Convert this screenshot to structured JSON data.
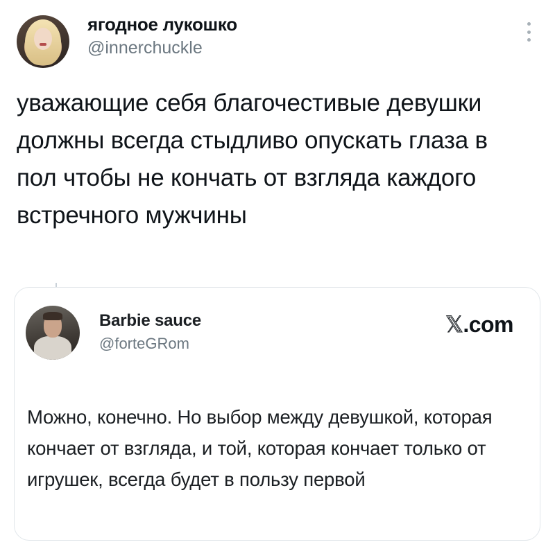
{
  "tweet": {
    "author": {
      "display_name": "ягодное лукошко",
      "handle": "@innerchuckle",
      "avatar_icon": "profile-photo-blonde-woman"
    },
    "more_icon": "vertical-ellipsis-icon",
    "text": "уважающие себя благочестивые девушки должны всегда стыдливо опускать глаза в пол чтобы не кончать от взгляда каждого встречного мужчины"
  },
  "quote": {
    "author": {
      "display_name": "Barbie sauce",
      "handle": "@forteGRom",
      "avatar_icon": "profile-photo-man"
    },
    "brand": {
      "mark": "𝕏",
      "domain": ".com"
    },
    "text": "Можно, конечно. Но выбор между девушкой, которая кончает от взгляда, и той, которая кончает только от игрушек, всегда будет в пользу первой"
  },
  "colors": {
    "text_primary": "#0f1419",
    "text_secondary": "#6b7780",
    "border": "#e1e6ea",
    "background": "#ffffff"
  }
}
